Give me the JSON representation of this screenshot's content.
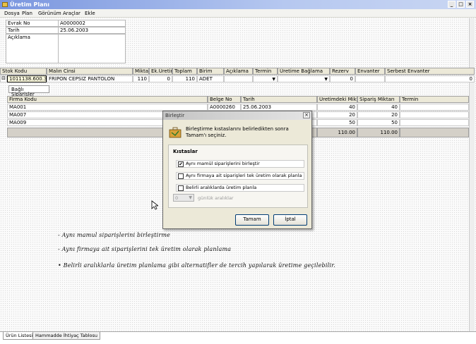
{
  "window": {
    "title": "Üretim Planı",
    "minimize": "_",
    "maximize": "□",
    "close": "×"
  },
  "menu": [
    "Dosya",
    "Plan",
    "Görünüm",
    "Araçlar",
    "Ekle"
  ],
  "form": {
    "evrak_label": "Evrak No",
    "evrak_value": "A0000002",
    "tarih_label": "Tarih",
    "tarih_value": "25.06.2003",
    "aciklama_label": "Açıklama",
    "aciklama_value": ""
  },
  "grid": {
    "headers": [
      "Stok Kodu",
      "Malın Cinsi",
      "Miktar",
      "Ek.Üretim",
      "Toplam",
      "Birim",
      "Açıklama",
      "Termin",
      "Üretime Bağlama",
      "Rezerv",
      "Envanter",
      "Serbest Envanter"
    ],
    "row": {
      "expander": "⊟",
      "stok_kodu": "1011138.600.38",
      "malin_cinsi": "FRİPON CEPSİZ PANTOLON",
      "miktar": "110",
      "ek_uretim": "0",
      "toplam": "110",
      "birim": "ADET",
      "aciklama": "",
      "termin": "",
      "uretime_baglama": "",
      "rezerv": "0",
      "envanter": "",
      "serbest_envanter": "0"
    }
  },
  "subtab": "Bağlı Siparişler",
  "subgrid": {
    "headers": [
      "Firma Kodu",
      "Belge No",
      "Tarih",
      "Üretimdeki Miktar",
      "Sipariş Miktarı",
      "Termin"
    ],
    "rows": [
      {
        "firma": "MA001",
        "belge": "A0000260",
        "tarih": "25.06.2003",
        "uretim": "40",
        "siparis": "40"
      },
      {
        "firma": "MA007",
        "belge": "",
        "tarih": "",
        "uretim": "20",
        "siparis": "20"
      },
      {
        "firma": "MA009",
        "belge": "",
        "tarih": "",
        "uretim": "50",
        "siparis": "50"
      }
    ],
    "total_uretim": "110.00",
    "total_siparis": "110.00"
  },
  "dialog": {
    "title": "Birleştir",
    "close": "×",
    "message": "Birleştirme kıstaslarını belirledikten sonra Tamam'ı seçiniz.",
    "group_title": "Kıstaslar",
    "options": [
      {
        "label": "Aynı mamül siparişlerini birleştir",
        "checked": true
      },
      {
        "label": "Aynı firmaya ait siparişleri tek üretim olarak planla",
        "checked": false
      },
      {
        "label": "Belirli aralıklarda üretim planla",
        "checked": false
      }
    ],
    "check_mark": "✔",
    "spin_value": "0",
    "spin_label": "günlük aralıklar",
    "ok": "Tamam",
    "cancel": "İptal"
  },
  "notes": [
    "-  Aynı mamul siparişlerini birleştirme",
    "-  Aynı firmaya ait siparişlerini tek üretim olarak planlama",
    "•  Belirli aralıklarla üretim planlama gibi alternatifler de tercih yapılarak üretime geçilebilir."
  ],
  "bottom_tabs": [
    "Ürün Listesi",
    "Hammadde İhtiyaç Tablosu"
  ]
}
